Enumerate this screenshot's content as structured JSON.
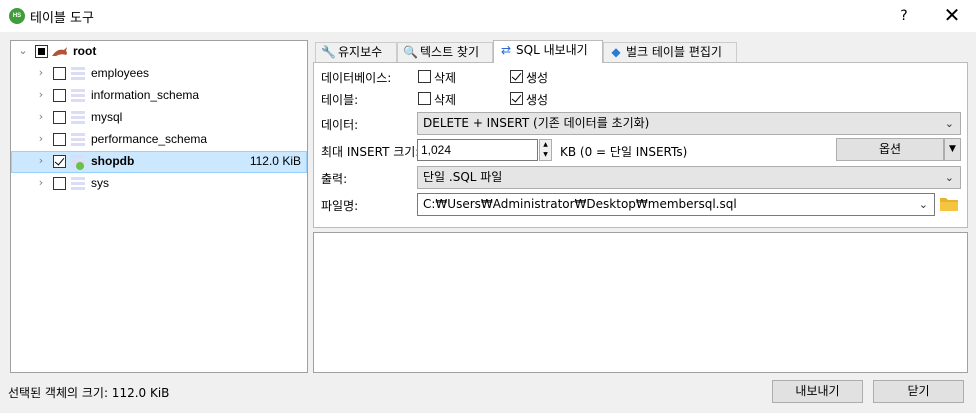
{
  "window": {
    "app_icon_text": "HS",
    "title": "테이블 도구",
    "help_label": "?",
    "close_label": "✕"
  },
  "tree": {
    "root": {
      "label": "root",
      "checkbox": "partial",
      "expanded": true
    },
    "items": [
      {
        "label": "employees",
        "checked": false,
        "size": ""
      },
      {
        "label": "information_schema",
        "checked": false,
        "size": ""
      },
      {
        "label": "mysql",
        "checked": false,
        "size": ""
      },
      {
        "label": "performance_schema",
        "checked": false,
        "size": ""
      },
      {
        "label": "shopdb",
        "checked": true,
        "size": "112.0 KiB",
        "selected": true
      },
      {
        "label": "sys",
        "checked": false,
        "size": ""
      }
    ]
  },
  "tabs": [
    {
      "label": "유지보수",
      "icon": "wrench-icon"
    },
    {
      "label": "텍스트 찾기",
      "icon": "magnifier-icon"
    },
    {
      "label": "SQL 내보내기",
      "icon": "export-arrows-icon",
      "active": true
    },
    {
      "label": "벌크 테이블 편집기",
      "icon": "stack-icon"
    }
  ],
  "export": {
    "database_label": "데이터베이스:",
    "table_label": "테이블:",
    "drop_label": "삭제",
    "create_label": "생성",
    "database_drop": false,
    "database_create": true,
    "table_drop": false,
    "table_create": true,
    "data_label": "데이터:",
    "data_value": "DELETE + INSERT (기존 데이터를 초기화)",
    "max_insert_label": "최대 INSERT 크기:",
    "max_insert_value": "1,024",
    "max_insert_unit": "KB (0 = 단일 INSERTs)",
    "options_label": "옵션",
    "output_label": "출력:",
    "output_value": "단일 .SQL 파일",
    "filename_label": "파일명:",
    "filename_value": "C:₩Users₩Administrator₩Desktop₩membersql.sql"
  },
  "footer": {
    "status": "선택된 객체의 크기: 112.0 KiB",
    "export_button": "내보내기",
    "close_button": "닫기"
  },
  "colors": {
    "selection": "#cce8ff",
    "selection_border": "#99d1ff",
    "app_icon": "#3f9d3a",
    "folder": "#f5c542"
  }
}
